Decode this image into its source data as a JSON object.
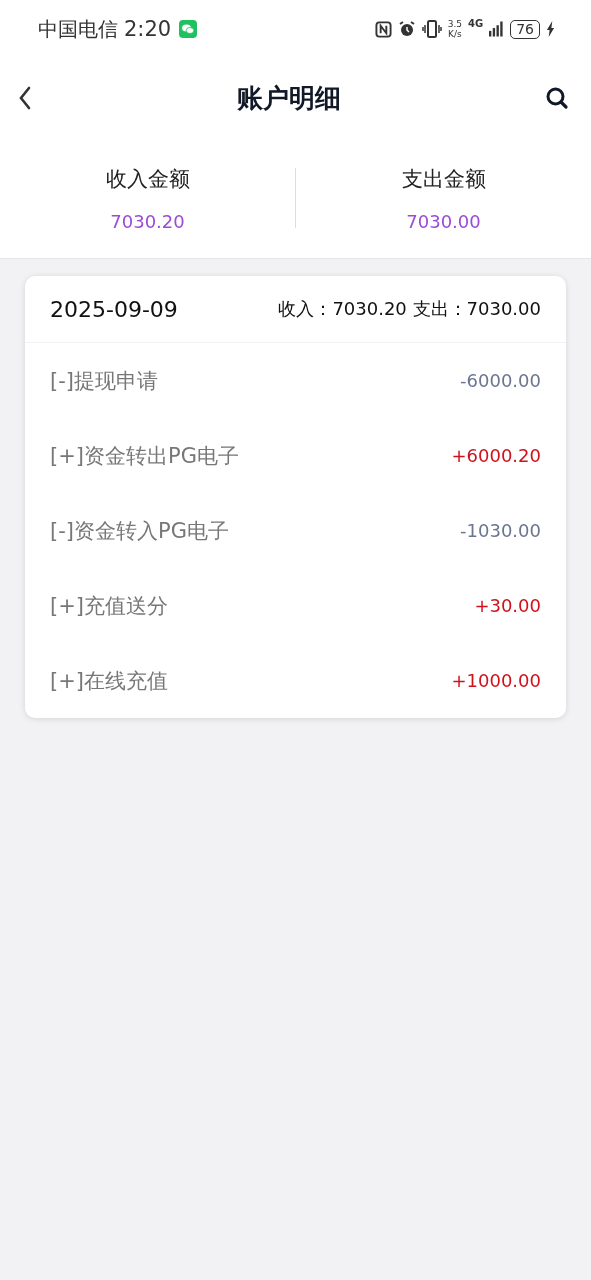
{
  "status_bar": {
    "carrier": "中国电信",
    "time": "2:20",
    "net_speed": "3.5",
    "net_speed_unit": "K/s",
    "network": "4G",
    "battery": "76"
  },
  "header": {
    "title": "账户明细"
  },
  "summary": [
    {
      "label": "收入金额",
      "value": "7030.20"
    },
    {
      "label": "支出金额",
      "value": "7030.00"
    }
  ],
  "day": {
    "date": "2025-09-09",
    "income": "收入：7030.20",
    "expense": "支出：7030.00",
    "rows": [
      {
        "label": "[-]提现申请",
        "amount": "-6000.00",
        "kind": "expense"
      },
      {
        "label": "[+]资金转出PG电子",
        "amount": "+6000.20",
        "kind": "income"
      },
      {
        "label": "[-]资金转入PG电子",
        "amount": "-1030.00",
        "kind": "expense"
      },
      {
        "label": "[+]充值送分",
        "amount": "+30.00",
        "kind": "income"
      },
      {
        "label": "[+]在线充值",
        "amount": "+1000.00",
        "kind": "income"
      }
    ]
  }
}
